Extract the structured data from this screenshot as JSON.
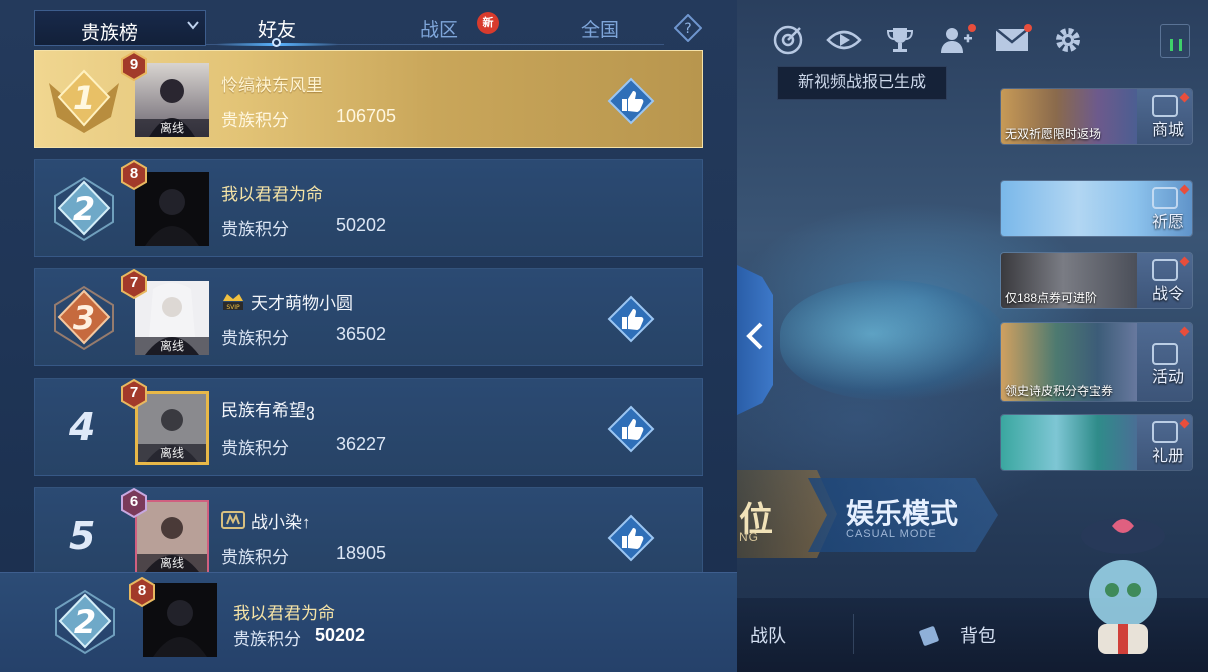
{
  "leaderboard": {
    "dropdown_label": "贵族榜",
    "tabs": [
      {
        "label": "好友",
        "active": true
      },
      {
        "label": "战区",
        "badge": "新"
      },
      {
        "label": "全国"
      }
    ],
    "help_label": "?",
    "score_label": "贵族积分",
    "offline_label": "离线",
    "rows": [
      {
        "rank": "1",
        "level": "9",
        "name": "怜缟袂东风里",
        "score": "106705",
        "status": "离线",
        "like": true
      },
      {
        "rank": "2",
        "level": "8",
        "name": "我以君君为命",
        "score": "50202",
        "status": "",
        "like": false
      },
      {
        "rank": "3",
        "level": "7",
        "name": "天才萌物小圆",
        "vip": "SVIP",
        "score": "36502",
        "status": "离线",
        "like": true
      },
      {
        "rank": "4",
        "level": "7",
        "name": "民族有希望ვ",
        "score": "36227",
        "status": "离线",
        "like": true
      },
      {
        "rank": "5",
        "level": "6",
        "name": "战小染↑",
        "score": "18905",
        "status": "离线",
        "like": true
      }
    ],
    "self": {
      "rank": "2",
      "level": "8",
      "name": "我以君君为命",
      "score_label": "贵族积分",
      "score": "50202"
    }
  },
  "lobby": {
    "tooltip": "新视频战报已生成",
    "top_icons": [
      "target-icon",
      "eye-icon",
      "trophy-icon",
      "friends-icon",
      "mail-icon",
      "gear-icon"
    ],
    "side_buttons": [
      {
        "sub": "无双祈愿限时返场",
        "label": "商城"
      },
      {
        "sub": "",
        "label": "祈愿"
      },
      {
        "sub": "仅188点券可进阶",
        "label": "战令"
      },
      {
        "sub": "领史诗皮积分夺宝券",
        "label": "活动"
      },
      {
        "sub": "",
        "label": "礼册"
      }
    ],
    "mode_left": {
      "big": "位",
      "small": "NG"
    },
    "mode_right": {
      "big": "娱乐模式",
      "small": "CASUAL MODE"
    },
    "bottom_items": [
      "战队",
      "背包"
    ]
  },
  "colors": {
    "gold_row": "#e3c477",
    "panel_bg": "#243a5c",
    "accent_blue": "#5ab4ff",
    "badge_red": "#d83b2d"
  }
}
